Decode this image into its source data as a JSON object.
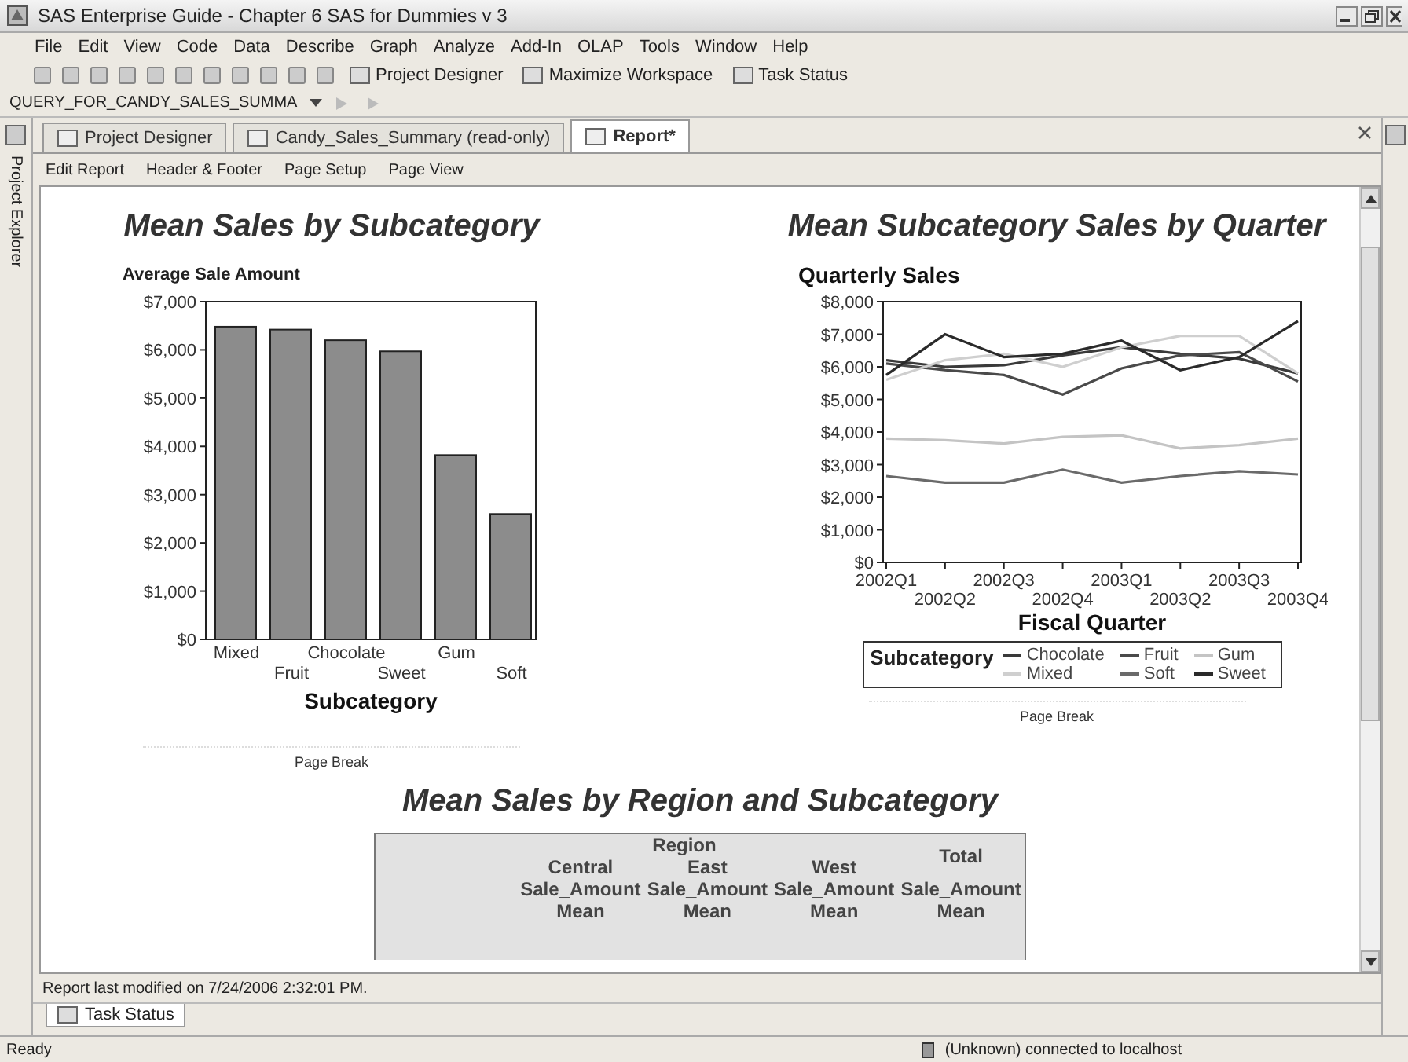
{
  "window": {
    "title": "SAS Enterprise Guide - Chapter 6 SAS for Dummies v 3"
  },
  "menu": [
    "File",
    "Edit",
    "View",
    "Code",
    "Data",
    "Describe",
    "Graph",
    "Analyze",
    "Add-In",
    "OLAP",
    "Tools",
    "Window",
    "Help"
  ],
  "toolbar": {
    "buttons": [
      "Project Designer",
      "Maximize Workspace",
      "Task Status"
    ],
    "query": "QUERY_FOR_CANDY_SALES_SUMMA"
  },
  "side_panel": {
    "label": "Project Explorer"
  },
  "tabs": [
    {
      "label": "Project Designer",
      "selected": false
    },
    {
      "label": "Candy_Sales_Summary (read-only)",
      "selected": false
    },
    {
      "label": "Report*",
      "selected": true
    }
  ],
  "report_toolbar": [
    "Edit Report",
    "Header & Footer",
    "Page Setup",
    "Page View"
  ],
  "report": {
    "bar_chart": {
      "heading": "Mean Sales by Subcategory",
      "chart_data": {
        "type": "bar",
        "title": "Average Sale Amount",
        "xlabel": "Subcategory",
        "categories": [
          "Mixed",
          "Fruit",
          "Chocolate",
          "Sweet",
          "Gum",
          "Soft"
        ],
        "values": [
          6480,
          6420,
          6200,
          5970,
          3820,
          2600
        ],
        "ylim": [
          0,
          7000
        ],
        "yticks": [
          {
            "value": 0,
            "label": "$0"
          },
          {
            "value": 1000,
            "label": "$1,000"
          },
          {
            "value": 2000,
            "label": "$2,000"
          },
          {
            "value": 3000,
            "label": "$3,000"
          },
          {
            "value": 4000,
            "label": "$4,000"
          },
          {
            "value": 5000,
            "label": "$5,000"
          },
          {
            "value": 6000,
            "label": "$6,000"
          },
          {
            "value": 7000,
            "label": "$7,000"
          }
        ]
      },
      "page_break": "Page Break"
    },
    "line_chart": {
      "heading": "Mean Subcategory Sales by Quarter",
      "chart_data": {
        "type": "line",
        "title": "Quarterly Sales",
        "xlabel": "Fiscal Quarter",
        "x": [
          "2002Q1",
          "2002Q2",
          "2002Q3",
          "2002Q4",
          "2003Q1",
          "2003Q2",
          "2003Q3",
          "2003Q4"
        ],
        "ylim": [
          0,
          8000
        ],
        "yticks": [
          {
            "value": 0,
            "label": "$0"
          },
          {
            "value": 1000,
            "label": "$1,000"
          },
          {
            "value": 2000,
            "label": "$2,000"
          },
          {
            "value": 3000,
            "label": "$3,000"
          },
          {
            "value": 4000,
            "label": "$4,000"
          },
          {
            "value": 5000,
            "label": "$5,000"
          },
          {
            "value": 6000,
            "label": "$6,000"
          },
          {
            "value": 7000,
            "label": "$7,000"
          },
          {
            "value": 8000,
            "label": "$8,000"
          }
        ],
        "legend": {
          "title": "Subcategory"
        },
        "series": [
          {
            "name": "Chocolate",
            "color": "#3a3a3a",
            "values": [
              6200,
              6000,
              6050,
              6350,
              6600,
              6400,
              6250,
              5800
            ]
          },
          {
            "name": "Fruit",
            "color": "#4a4a4a",
            "values": [
              6100,
              5900,
              5750,
              5150,
              5950,
              6350,
              6450,
              5550
            ]
          },
          {
            "name": "Gum",
            "color": "#c4c4c4",
            "values": [
              3800,
              3750,
              3650,
              3850,
              3900,
              3500,
              3600,
              3800
            ]
          },
          {
            "name": "Mixed",
            "color": "#cfcfcf",
            "values": [
              5600,
              6200,
              6400,
              6000,
              6600,
              6950,
              6950,
              5800
            ]
          },
          {
            "name": "Soft",
            "color": "#6a6a6a",
            "values": [
              2650,
              2450,
              2450,
              2850,
              2450,
              2650,
              2800,
              2700
            ]
          },
          {
            "name": "Sweet",
            "color": "#2a2a2a",
            "values": [
              5750,
              7000,
              6300,
              6400,
              6800,
              5900,
              6300,
              7400
            ]
          }
        ]
      },
      "page_break": "Page Break"
    },
    "table": {
      "heading": "Mean Sales by Region and Subcategory",
      "group": "Region",
      "columns": [
        {
          "name": "Central",
          "measure": "Sale_Amount",
          "stat": "Mean",
          "grouped": true
        },
        {
          "name": "East",
          "measure": "Sale_Amount",
          "stat": "Mean",
          "grouped": true
        },
        {
          "name": "West",
          "measure": "Sale_Amount",
          "stat": "Mean",
          "grouped": true
        },
        {
          "name": "Total",
          "measure": "Sale_Amount",
          "stat": "Mean",
          "grouped": false
        }
      ]
    }
  },
  "report_status": "Report last modified on 7/24/2006 2:32:01 PM.",
  "bottom_tab": "Task Status",
  "status_bar": {
    "left": "Ready",
    "right": "(Unknown) connected to localhost"
  }
}
